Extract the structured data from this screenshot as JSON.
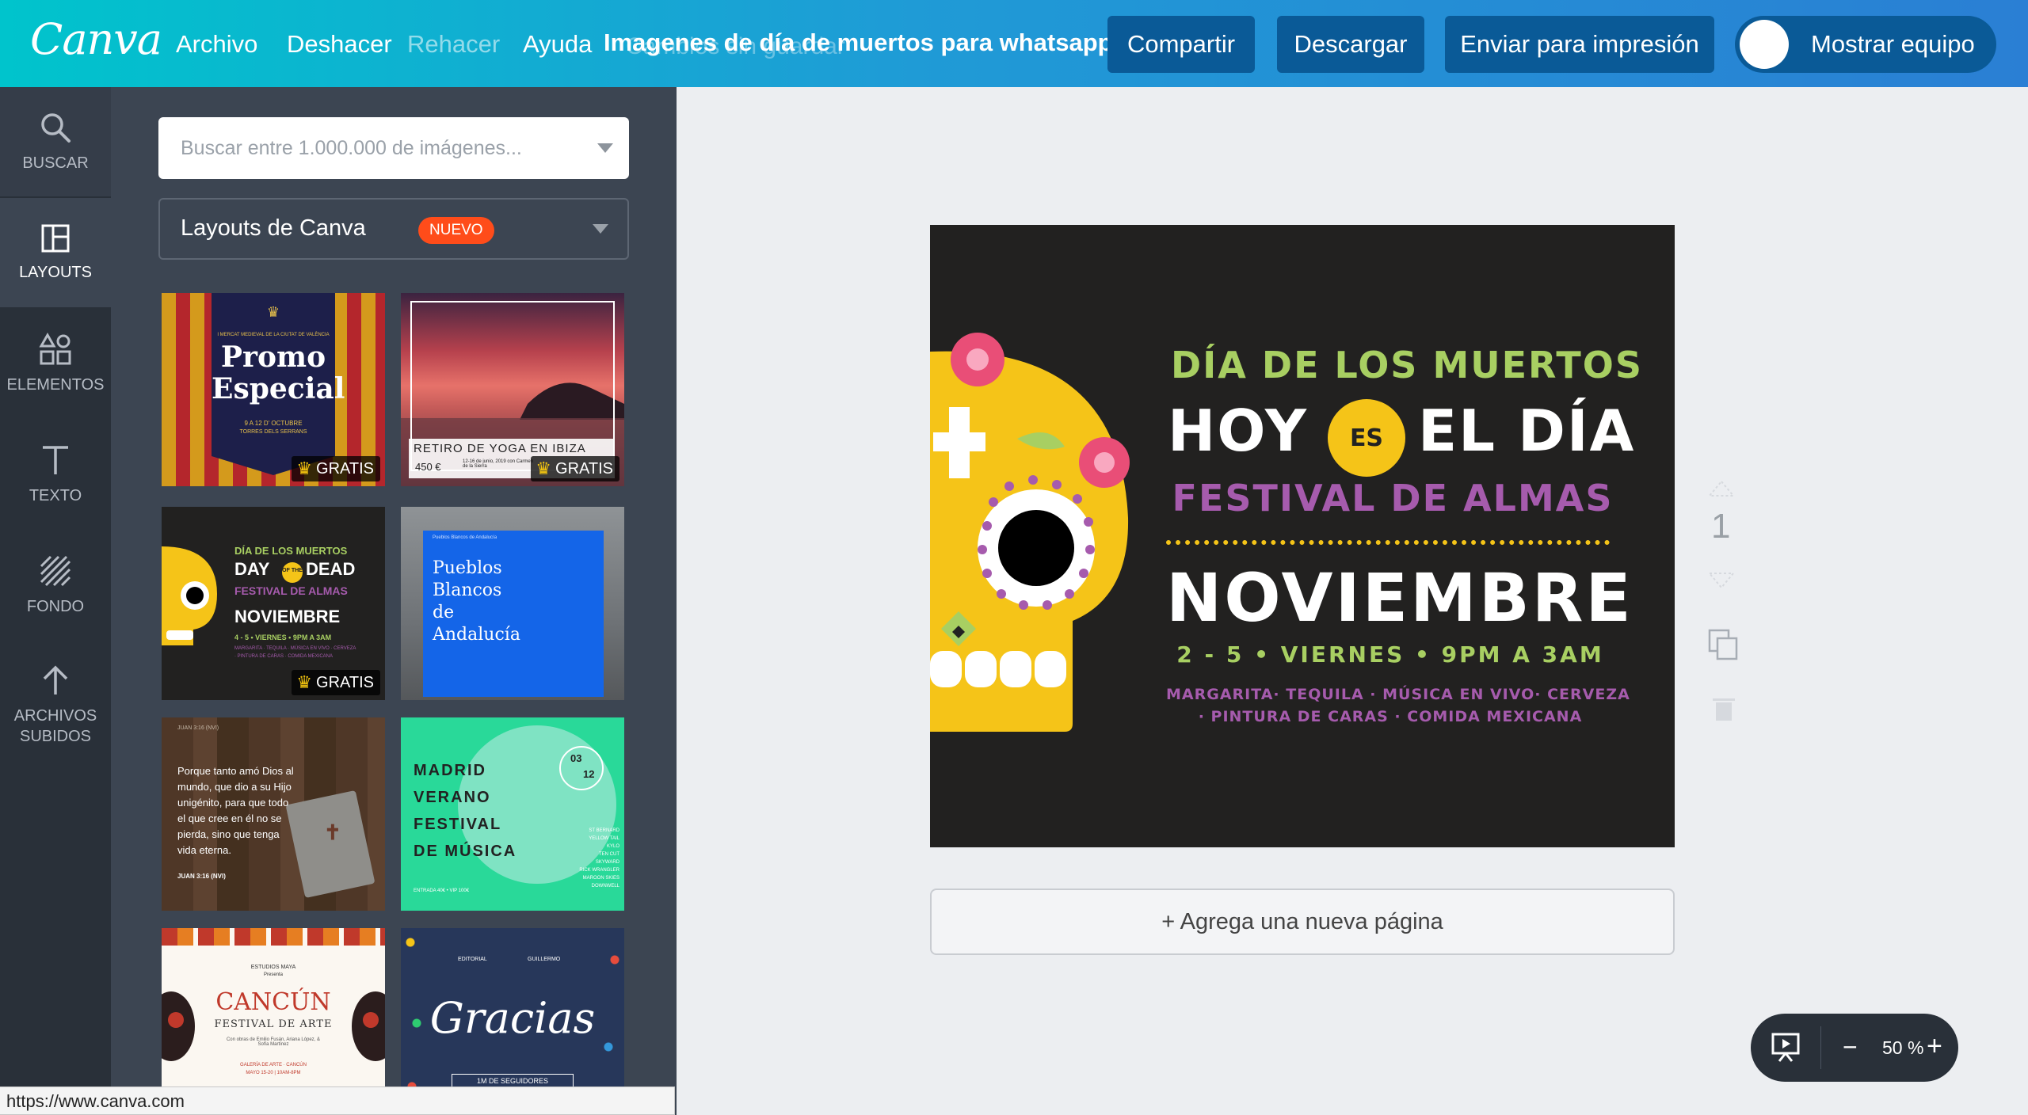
{
  "topbar": {
    "logo": "Canva",
    "menu": [
      "Archivo",
      "Deshacer",
      "Rehacer",
      "Ayuda"
    ],
    "document_title": "Imagenes de día de muertos para whatsapp",
    "save_status": "Cambios sin guardar",
    "buttons": {
      "share": "Compartir",
      "download": "Descargar",
      "print": "Enviar para impresión",
      "team": "Mostrar equipo"
    }
  },
  "leftnav": {
    "items": [
      {
        "label": "BUSCAR",
        "icon": "search-icon"
      },
      {
        "label": "LAYOUTS",
        "icon": "layouts-icon"
      },
      {
        "label": "ELEMENTOS",
        "icon": "elements-icon"
      },
      {
        "label": "TEXTO",
        "icon": "text-icon"
      },
      {
        "label": "FONDO",
        "icon": "background-icon"
      },
      {
        "label": "ARCHIVOS SUBIDOS",
        "icon": "upload-icon"
      }
    ]
  },
  "panel": {
    "search_placeholder": "Buscar entre 1.000.000 de imágenes...",
    "layout_select": "Layouts de Canva",
    "new_badge": "NUEVO",
    "free_label": "GRATIS",
    "thumbs": {
      "t1": {
        "top": "I MERCAT MEDIEVAL DE LA CIUTAT DE VALÈNCIA",
        "title1": "Promo",
        "title2": "Especial",
        "date": "9 A 12 D' OCTUBRE",
        "place": "TORRES DELS SERRANS"
      },
      "t2": {
        "title": "RETIRO DE YOGA EN IBIZA",
        "price": "450 €",
        "info": "12-16 de junio, 2019 con Carmen de la Sierra"
      },
      "t3": {
        "l1": "DÍA DE LOS MUERTOS",
        "day": "DAY",
        "ofthe": "OF THE",
        "dead": "DEAD",
        "l3": "FESTIVAL DE ALMAS",
        "l4": "NOVIEMBRE",
        "l5": "4 - 5 • VIERNES • 9PM A 3AM",
        "l6": "MARGARITA · TEQUILA · MÚSICA EN VIVO · CERVEZA",
        "l7": "· PINTURA DE CARAS · COMIDA MEXICANA"
      },
      "t4": {
        "header": "Pueblos Blancos de Andalucía",
        "title": "Pueblos Blancos de Andalucía"
      },
      "t5": {
        "ref": "JUAN 3:16 (NVI)",
        "quote": "Porque tanto amó Dios al mundo, que dio a su Hijo unigénito, para que todo el que cree en él no se pierda, sino que tenga vida eterna.",
        "cite": "JUAN 3:16 (NVI)"
      },
      "t6": {
        "lines": [
          "MADRID",
          "VERANO",
          "FESTIVAL",
          "DE MÚSICA"
        ],
        "date_top": "03",
        "date_bottom": "12",
        "lineup": [
          "ST BERNARD",
          "YELLOW TAIL",
          "KYLO",
          "TEN CUT",
          "SKYWARD",
          "RICK WRANGLER",
          "MAROON SKIES",
          "DOWNWELL"
        ],
        "footer": "ENTRADA 40€ • VIP 100€"
      },
      "t7": {
        "top": "ESTUDIOS MAYA",
        "sub": "Presenta",
        "title": "CANCÚN",
        "subtitle": "FESTIVAL DE ARTE",
        "credits": "Con obras de Emilio Fusán, Ariana López, & Sofía Martínez",
        "venue": "GALERÍA DE ARTE · CANCÚN",
        "dates": "MAYO 15-20 | 10AM-8PM"
      },
      "t8": {
        "top_left": "EDITORIAL",
        "top_right": "GUILLERMO",
        "title": "Gracias",
        "footer": "1M DE SEGUIDORES"
      }
    }
  },
  "design": {
    "line1": "DÍA DE LOS MUERTOS",
    "hoy": "HOY",
    "es": "ES",
    "el_dia": "EL DÍA",
    "line3": "FESTIVAL DE ALMAS",
    "month": "NOVIEMBRE",
    "details": "2 - 5  •  VIERNES •  9PM A 3AM",
    "extras1": "MARGARITA· TEQUILA · MÚSICA EN VIVO· CERVEZA",
    "extras2": "· PINTURA DE CARAS · COMIDA MEXICANA"
  },
  "canvas": {
    "page_number": "1",
    "add_page": "+ Agrega una nueva página",
    "zoom": "50 %"
  },
  "status_url": "https://www.canva.com",
  "colors": {
    "accent_top_left": "#00c4cc",
    "accent_top_right": "#2a7fd4",
    "button_dark": "#0a5a97",
    "panel": "#3c4552",
    "nav": "#293039",
    "design_bg": "#222120",
    "design_green": "#a8cf62",
    "design_purple": "#a65bad",
    "design_yellow": "#f5c418",
    "badge_orange": "#ff4c1a"
  }
}
